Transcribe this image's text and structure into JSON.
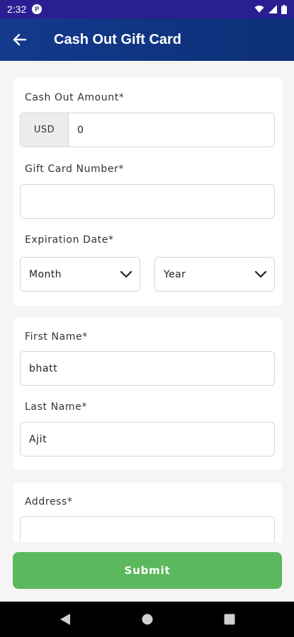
{
  "status_bar": {
    "time": "2:32",
    "notification_badge": "P"
  },
  "header": {
    "title": "Cash Out Gift Card"
  },
  "card_amount": {
    "amount_label": "Cash Out Amount*",
    "currency": "USD",
    "amount_value": "0",
    "gift_card_label": "Gift Card Number*",
    "gift_card_value": "",
    "expiration_label": "Expiration Date*",
    "month_selected": "Month",
    "year_selected": "Year"
  },
  "card_name": {
    "first_name_label": "First Name*",
    "first_name_value": "bhatt",
    "last_name_label": "Last Name*",
    "last_name_value": "Ajit"
  },
  "card_address": {
    "address_label": "Address*",
    "address_value": ""
  },
  "actions": {
    "submit_label": "Submit"
  },
  "colors": {
    "status_bar": "#2a1f92",
    "header": "#133a8c",
    "submit": "#5cb85c",
    "background": "#f5f5f6"
  },
  "icons": {
    "back": "arrow-left-icon",
    "dropdown": "chevron-down-icon",
    "wifi": "wifi-icon",
    "signal": "signal-icon",
    "battery": "battery-icon",
    "nav_back": "nav-back-icon",
    "nav_home": "nav-home-icon",
    "nav_recents": "nav-recents-icon"
  }
}
